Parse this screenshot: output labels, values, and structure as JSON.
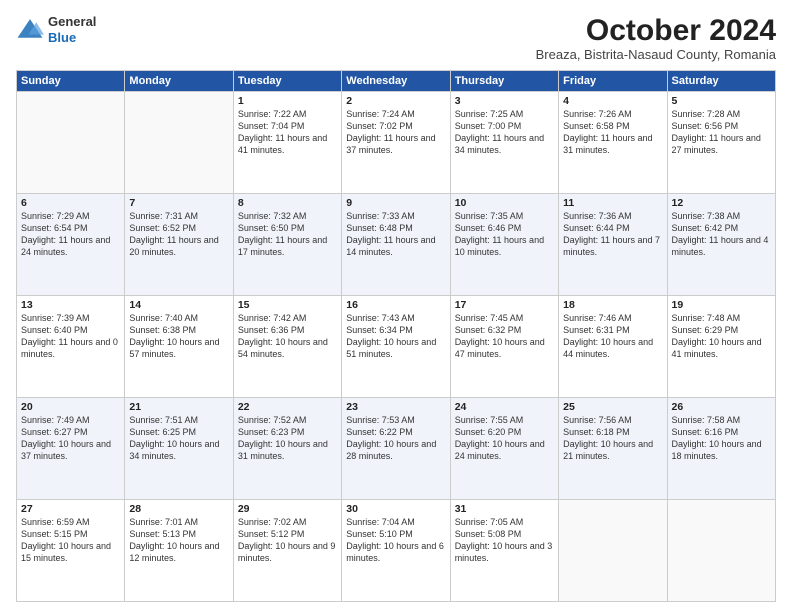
{
  "logo": {
    "general": "General",
    "blue": "Blue"
  },
  "header": {
    "month": "October 2024",
    "location": "Breaza, Bistrita-Nasaud County, Romania"
  },
  "days_of_week": [
    "Sunday",
    "Monday",
    "Tuesday",
    "Wednesday",
    "Thursday",
    "Friday",
    "Saturday"
  ],
  "weeks": [
    [
      {
        "day": "",
        "content": ""
      },
      {
        "day": "",
        "content": ""
      },
      {
        "day": "1",
        "content": "Sunrise: 7:22 AM\nSunset: 7:04 PM\nDaylight: 11 hours and 41 minutes."
      },
      {
        "day": "2",
        "content": "Sunrise: 7:24 AM\nSunset: 7:02 PM\nDaylight: 11 hours and 37 minutes."
      },
      {
        "day": "3",
        "content": "Sunrise: 7:25 AM\nSunset: 7:00 PM\nDaylight: 11 hours and 34 minutes."
      },
      {
        "day": "4",
        "content": "Sunrise: 7:26 AM\nSunset: 6:58 PM\nDaylight: 11 hours and 31 minutes."
      },
      {
        "day": "5",
        "content": "Sunrise: 7:28 AM\nSunset: 6:56 PM\nDaylight: 11 hours and 27 minutes."
      }
    ],
    [
      {
        "day": "6",
        "content": "Sunrise: 7:29 AM\nSunset: 6:54 PM\nDaylight: 11 hours and 24 minutes."
      },
      {
        "day": "7",
        "content": "Sunrise: 7:31 AM\nSunset: 6:52 PM\nDaylight: 11 hours and 20 minutes."
      },
      {
        "day": "8",
        "content": "Sunrise: 7:32 AM\nSunset: 6:50 PM\nDaylight: 11 hours and 17 minutes."
      },
      {
        "day": "9",
        "content": "Sunrise: 7:33 AM\nSunset: 6:48 PM\nDaylight: 11 hours and 14 minutes."
      },
      {
        "day": "10",
        "content": "Sunrise: 7:35 AM\nSunset: 6:46 PM\nDaylight: 11 hours and 10 minutes."
      },
      {
        "day": "11",
        "content": "Sunrise: 7:36 AM\nSunset: 6:44 PM\nDaylight: 11 hours and 7 minutes."
      },
      {
        "day": "12",
        "content": "Sunrise: 7:38 AM\nSunset: 6:42 PM\nDaylight: 11 hours and 4 minutes."
      }
    ],
    [
      {
        "day": "13",
        "content": "Sunrise: 7:39 AM\nSunset: 6:40 PM\nDaylight: 11 hours and 0 minutes."
      },
      {
        "day": "14",
        "content": "Sunrise: 7:40 AM\nSunset: 6:38 PM\nDaylight: 10 hours and 57 minutes."
      },
      {
        "day": "15",
        "content": "Sunrise: 7:42 AM\nSunset: 6:36 PM\nDaylight: 10 hours and 54 minutes."
      },
      {
        "day": "16",
        "content": "Sunrise: 7:43 AM\nSunset: 6:34 PM\nDaylight: 10 hours and 51 minutes."
      },
      {
        "day": "17",
        "content": "Sunrise: 7:45 AM\nSunset: 6:32 PM\nDaylight: 10 hours and 47 minutes."
      },
      {
        "day": "18",
        "content": "Sunrise: 7:46 AM\nSunset: 6:31 PM\nDaylight: 10 hours and 44 minutes."
      },
      {
        "day": "19",
        "content": "Sunrise: 7:48 AM\nSunset: 6:29 PM\nDaylight: 10 hours and 41 minutes."
      }
    ],
    [
      {
        "day": "20",
        "content": "Sunrise: 7:49 AM\nSunset: 6:27 PM\nDaylight: 10 hours and 37 minutes."
      },
      {
        "day": "21",
        "content": "Sunrise: 7:51 AM\nSunset: 6:25 PM\nDaylight: 10 hours and 34 minutes."
      },
      {
        "day": "22",
        "content": "Sunrise: 7:52 AM\nSunset: 6:23 PM\nDaylight: 10 hours and 31 minutes."
      },
      {
        "day": "23",
        "content": "Sunrise: 7:53 AM\nSunset: 6:22 PM\nDaylight: 10 hours and 28 minutes."
      },
      {
        "day": "24",
        "content": "Sunrise: 7:55 AM\nSunset: 6:20 PM\nDaylight: 10 hours and 24 minutes."
      },
      {
        "day": "25",
        "content": "Sunrise: 7:56 AM\nSunset: 6:18 PM\nDaylight: 10 hours and 21 minutes."
      },
      {
        "day": "26",
        "content": "Sunrise: 7:58 AM\nSunset: 6:16 PM\nDaylight: 10 hours and 18 minutes."
      }
    ],
    [
      {
        "day": "27",
        "content": "Sunrise: 6:59 AM\nSunset: 5:15 PM\nDaylight: 10 hours and 15 minutes."
      },
      {
        "day": "28",
        "content": "Sunrise: 7:01 AM\nSunset: 5:13 PM\nDaylight: 10 hours and 12 minutes."
      },
      {
        "day": "29",
        "content": "Sunrise: 7:02 AM\nSunset: 5:12 PM\nDaylight: 10 hours and 9 minutes."
      },
      {
        "day": "30",
        "content": "Sunrise: 7:04 AM\nSunset: 5:10 PM\nDaylight: 10 hours and 6 minutes."
      },
      {
        "day": "31",
        "content": "Sunrise: 7:05 AM\nSunset: 5:08 PM\nDaylight: 10 hours and 3 minutes."
      },
      {
        "day": "",
        "content": ""
      },
      {
        "day": "",
        "content": ""
      }
    ]
  ]
}
